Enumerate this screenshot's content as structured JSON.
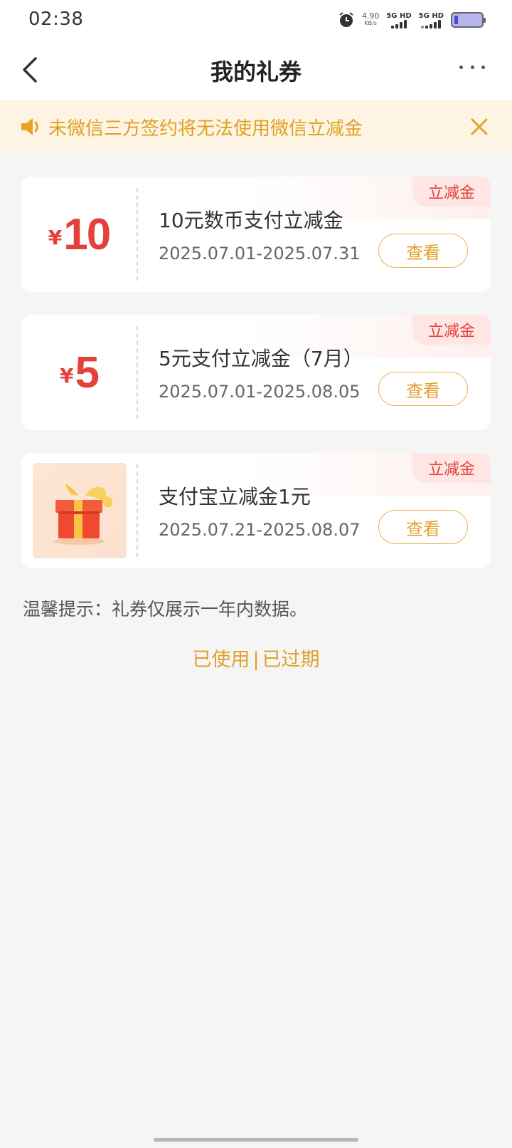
{
  "status_bar": {
    "time": "02:38",
    "net_speed_value": "4.90",
    "net_speed_unit": "KB/s",
    "sim1_label": "5G HD",
    "sim2_label": "5G HD",
    "icons": [
      "alarm-icon",
      "signal-icon",
      "battery-icon"
    ]
  },
  "header": {
    "title": "我的礼券",
    "back_icon": "chevron-left-icon",
    "more_icon": "more-dots-icon"
  },
  "notice": {
    "text": "未微信三方签约将无法使用微信立减金",
    "icon": "speaker-icon",
    "close_icon": "close-icon"
  },
  "coupons": [
    {
      "currency": "¥",
      "amount": "10",
      "name": "10元数币支付立减金",
      "date_range": "2025.07.01-2025.07.31",
      "tag": "立减金",
      "button": "查看"
    },
    {
      "currency": "¥",
      "amount": "5",
      "name": "5元支付立减金（7月）",
      "date_range": "2025.07.01-2025.08.05",
      "tag": "立减金",
      "button": "查看"
    },
    {
      "image": "gift-box-icon",
      "name": "支付宝立减金1元",
      "date_range": "2025.07.21-2025.08.07",
      "tag": "立减金",
      "button": "查看"
    }
  ],
  "tip": "温馨提示：礼券仅展示一年内数据。",
  "history": {
    "used": "已使用",
    "separator": "|",
    "expired": "已过期"
  },
  "colors": {
    "accent_red": "#e5413a",
    "accent_gold": "#e3a02c",
    "notice_bg": "#fdf4e3",
    "page_bg": "#f5f5f5"
  }
}
